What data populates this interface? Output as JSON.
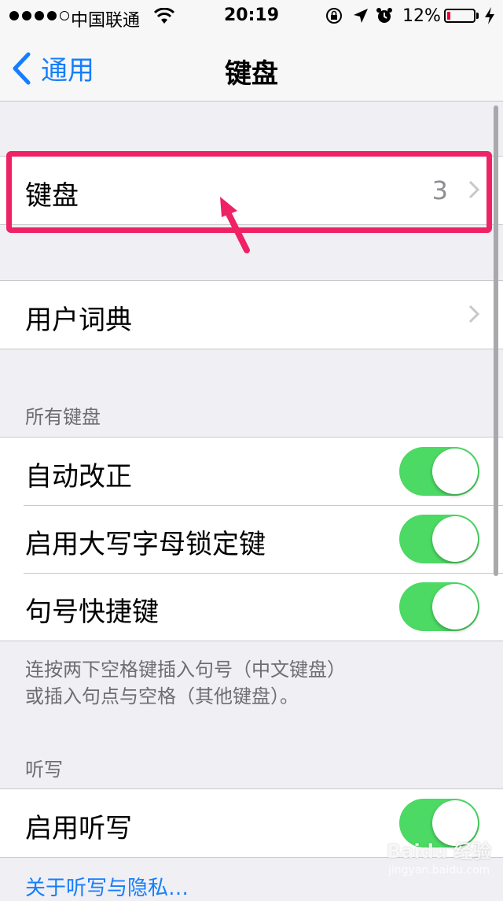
{
  "status_bar": {
    "carrier": "中国联通",
    "time": "20:19",
    "battery_percent": "12%",
    "battery_level": 0.12,
    "signal_strength": 4,
    "signal_max": 5
  },
  "nav": {
    "back_label": "通用",
    "title": "键盘"
  },
  "keyboards_row": {
    "label": "键盘",
    "value": "3"
  },
  "dictionary_row": {
    "label": "用户词典"
  },
  "all_keyboards": {
    "header": "所有键盘",
    "rows": [
      {
        "label": "自动改正",
        "on": true
      },
      {
        "label": "启用大写字母锁定键",
        "on": true
      },
      {
        "label": "句号快捷键",
        "on": true
      }
    ],
    "footer_line1": "连按两下空格键插入句号（中文键盘）",
    "footer_line2": "或插入句点与空格（其他键盘）。"
  },
  "dictation": {
    "header": "听写",
    "row": {
      "label": "启用听写",
      "on": true
    },
    "link": "关于听写与隐私…"
  },
  "watermark": {
    "brand": "Baidu 经验",
    "url": "jingyan.baidu.com"
  },
  "colors": {
    "accent": "#157efb",
    "switch_on": "#4cd964",
    "highlight": "#ee2264",
    "background": "#efeff4"
  }
}
